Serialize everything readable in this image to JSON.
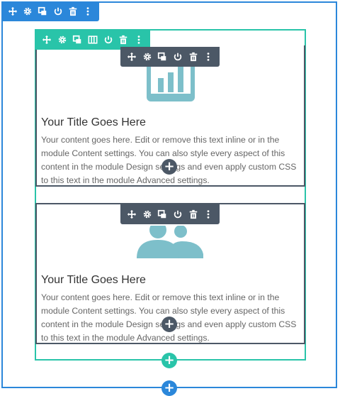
{
  "colors": {
    "section": "#2b87da",
    "row": "#29c4a9",
    "module": "#4c5866",
    "icon": "#7dbfca",
    "title": "#333333",
    "body_text": "#666666"
  },
  "section_toolbar": {
    "buttons": [
      "move-icon",
      "gear-icon",
      "duplicate-icon",
      "power-icon",
      "trash-icon",
      "more-icon"
    ]
  },
  "row_toolbar": {
    "buttons": [
      "move-icon",
      "gear-icon",
      "duplicate-icon",
      "columns-icon",
      "power-icon",
      "trash-icon",
      "more-icon"
    ]
  },
  "module_toolbar": {
    "buttons": [
      "move-icon",
      "gear-icon",
      "duplicate-icon",
      "power-icon",
      "trash-icon",
      "more-icon"
    ]
  },
  "modules": [
    {
      "icon": "bar-chart-icon",
      "title": "Your Title Goes Here",
      "text": "Your content goes here. Edit or remove this text inline or in the module Content settings. You can also style every aspect of this content in the module Design settings and even apply custom CSS to this text in the module Advanced settings."
    },
    {
      "icon": "users-icon",
      "title": "Your Title Goes Here",
      "text": "Your content goes here. Edit or remove this text inline or in the module Content settings. You can also style every aspect of this content in the module Design settings and even apply custom CSS to this text in the module Advanced settings."
    }
  ],
  "add_buttons": {
    "module_label": "+",
    "row_label": "+",
    "section_label": "+"
  }
}
